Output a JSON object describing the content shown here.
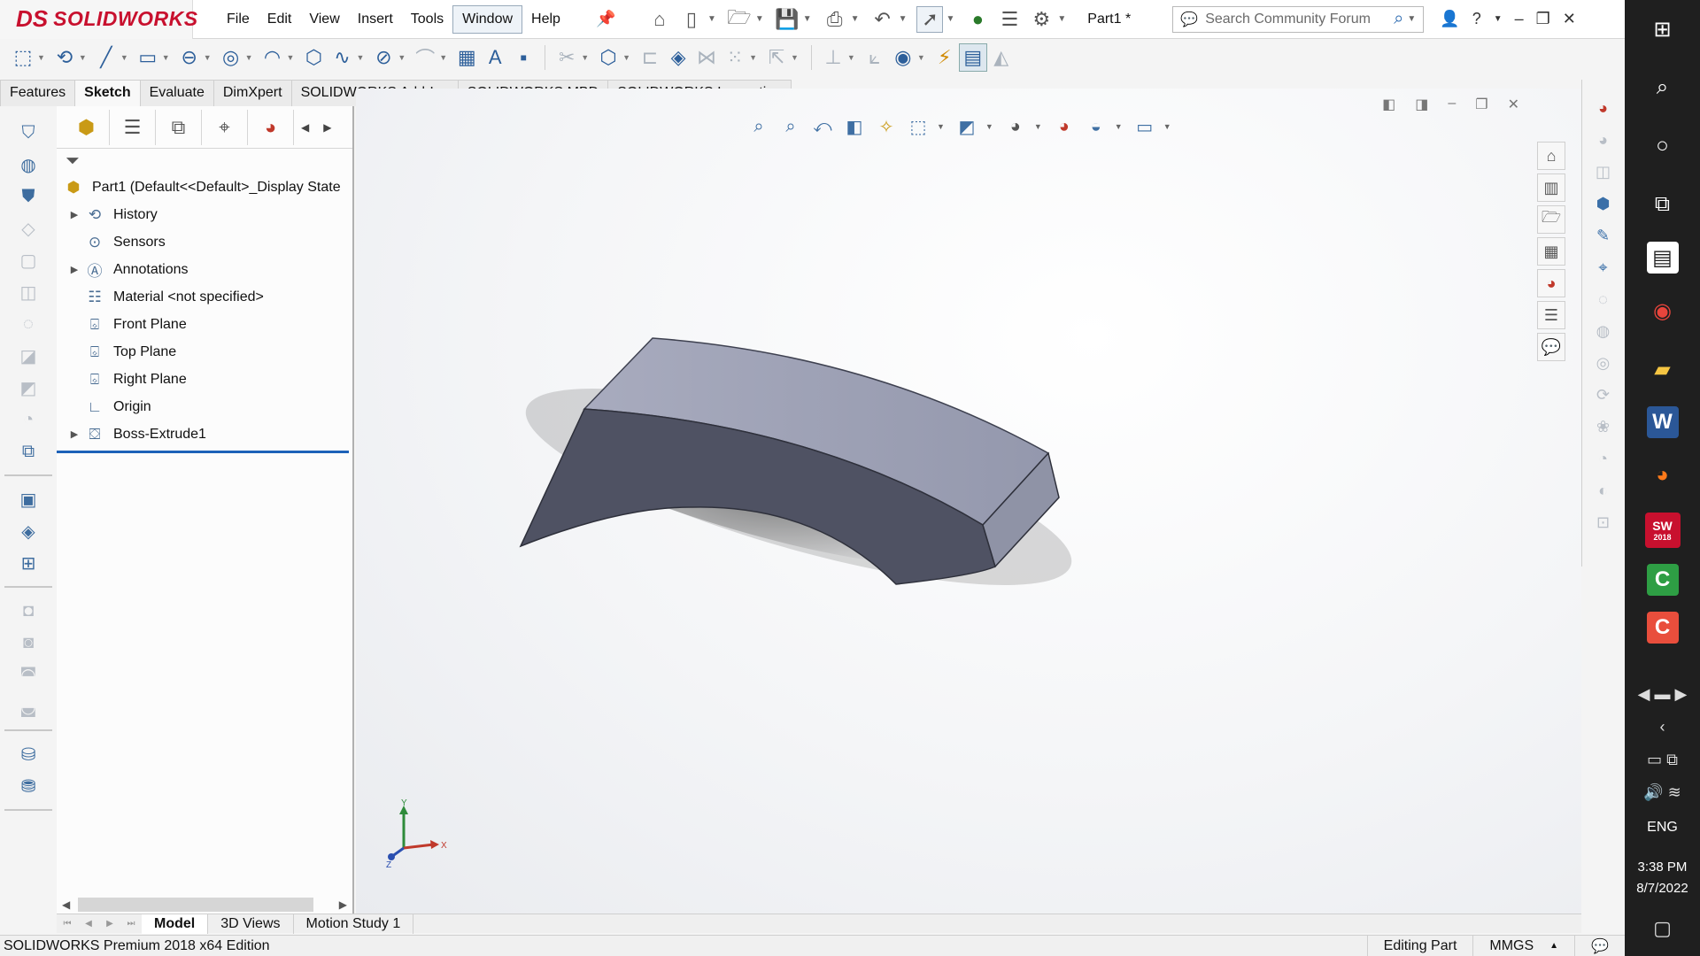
{
  "titlebar": {
    "logo_ds": "DS",
    "logo_text": "SOLIDWORKS",
    "menus": [
      "File",
      "Edit",
      "View",
      "Insert",
      "Tools",
      "Window",
      "Help"
    ],
    "document_title": "Part1 *",
    "search_placeholder": "Search Community Forum"
  },
  "tabs": [
    "Features",
    "Sketch",
    "Evaluate",
    "DimXpert",
    "SOLIDWORKS Add-Ins",
    "SOLIDWORKS MBD",
    "SOLIDWORKS Inspection"
  ],
  "feature_tree": {
    "root": "Part1  (Default<<Default>_Display State",
    "items": [
      "History",
      "Sensors",
      "Annotations",
      "Material <not specified>",
      "Front Plane",
      "Top Plane",
      "Right Plane",
      "Origin",
      "Boss-Extrude1"
    ]
  },
  "triad": {
    "x": "X",
    "y": "Y",
    "z": "Z"
  },
  "bottom_tabs": [
    "Model",
    "3D Views",
    "Motion Study 1"
  ],
  "status": {
    "edition": "SOLIDWORKS Premium 2018 x64 Edition",
    "mode": "Editing Part",
    "units": "MMGS"
  },
  "windows": {
    "language": "ENG",
    "time": "3:38 PM",
    "date": "8/7/2022",
    "sw_badge": "2018"
  },
  "colors": {
    "brand": "#c8102e",
    "part_top": "#9fa3b7",
    "part_side": "#4f5263",
    "selection_blue": "#1d62b8"
  }
}
